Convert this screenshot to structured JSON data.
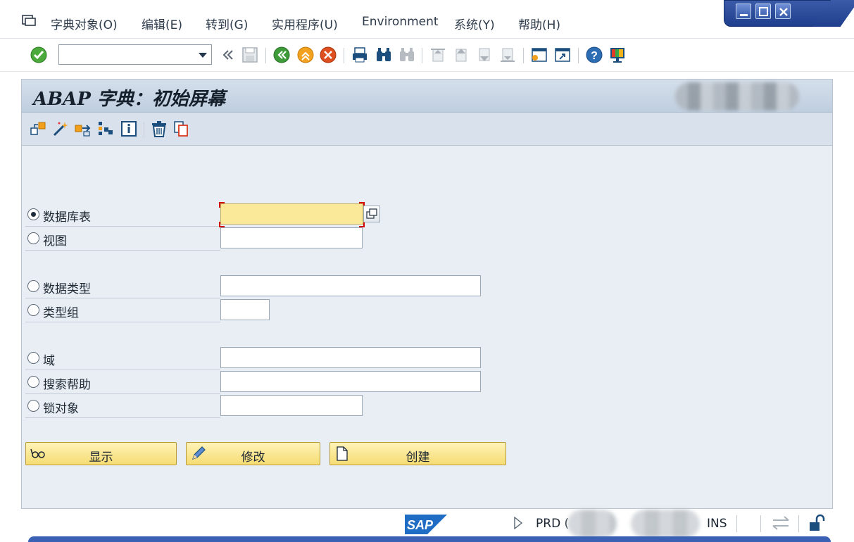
{
  "menu": {
    "items": [
      "字典对象(O)",
      "编辑(E)",
      "转到(G)",
      "实用程序(U)",
      "Environment",
      "系统(Y)",
      "帮助(H)"
    ]
  },
  "toolbar": {
    "command_field": {
      "value": "",
      "placeholder": ""
    },
    "icons": [
      "enter-icon",
      "back-double-icon",
      "save-icon",
      "back-icon",
      "exit-icon",
      "cancel-icon",
      "print-icon",
      "find-icon",
      "find-next-icon",
      "first-page-icon",
      "previous-page-icon",
      "next-page-icon",
      "last-page-icon",
      "new-session-icon",
      "shortcut-icon",
      "help-icon",
      "layout-icon"
    ]
  },
  "screen": {
    "title": "ABAP 字典：初始屏幕"
  },
  "app_toolbar": {
    "icons": [
      "other-object-icon",
      "wizard-icon",
      "check-icon",
      "activate-icon",
      "info-icon",
      "delete-icon",
      "copy-icon"
    ]
  },
  "form": {
    "options": [
      {
        "label": "数据库表",
        "selected": true,
        "value": ""
      },
      {
        "label": "视图",
        "selected": false,
        "value": ""
      },
      {
        "label": "数据类型",
        "selected": false,
        "value": ""
      },
      {
        "label": "类型组",
        "selected": false,
        "value": ""
      },
      {
        "label": "域",
        "selected": false,
        "value": ""
      },
      {
        "label": "搜索帮助",
        "selected": false,
        "value": ""
      },
      {
        "label": "锁对象",
        "selected": false,
        "value": ""
      }
    ]
  },
  "buttons": {
    "display": "显示",
    "change": "修改",
    "create": "创建"
  },
  "status": {
    "system": "PRD (",
    "mode": "INS"
  },
  "colors": {
    "focus_field": "#fbe99a",
    "button": "#f6dc73",
    "panel": "#e9eef4",
    "title_bar": "#c8d5e3",
    "window_control": "#2a4c9c"
  }
}
